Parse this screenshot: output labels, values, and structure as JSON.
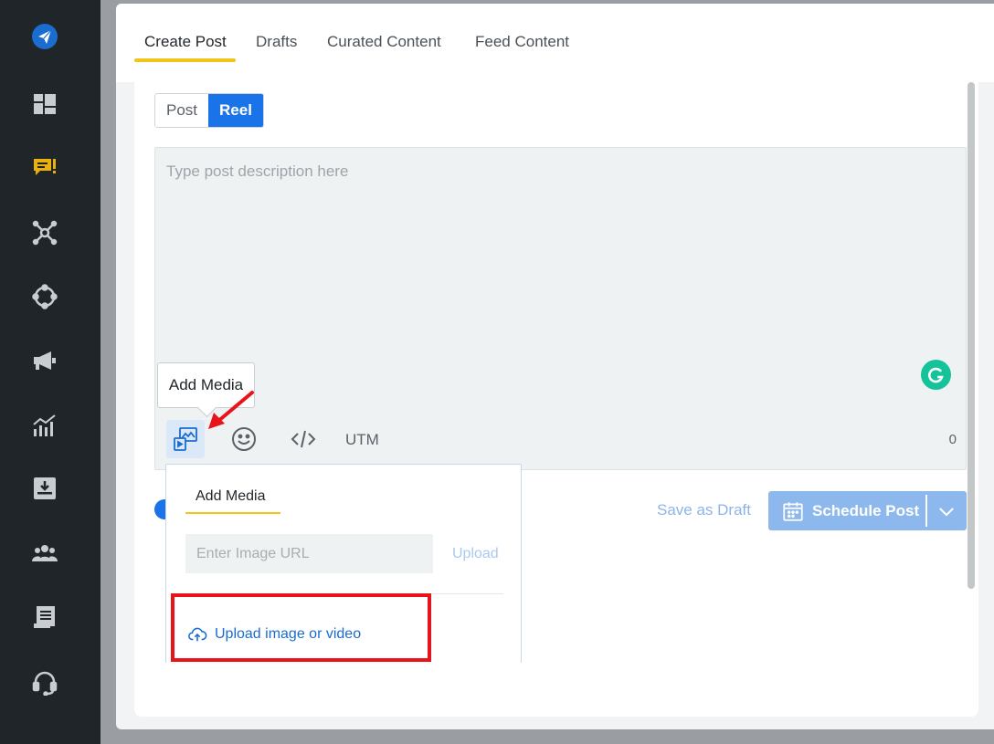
{
  "sidebar": {
    "items": [
      {
        "icon": "paper-plane-logo-icon",
        "color": "#1a6ccf"
      },
      {
        "icon": "dashboard-icon",
        "color": "#c9cdd1"
      },
      {
        "icon": "chat-post-icon",
        "color": "#e8b10e"
      },
      {
        "icon": "network-icon",
        "color": "#c9cdd1"
      },
      {
        "icon": "circle-nodes-icon",
        "color": "#c9cdd1"
      },
      {
        "icon": "megaphone-icon",
        "color": "#c9cdd1"
      },
      {
        "icon": "analytics-icon",
        "color": "#c9cdd1"
      },
      {
        "icon": "inbox-download-icon",
        "color": "#c9cdd1"
      },
      {
        "icon": "team-icon",
        "color": "#c9cdd1"
      },
      {
        "icon": "report-icon",
        "color": "#c9cdd1"
      },
      {
        "icon": "headset-icon",
        "color": "#c9cdd1"
      }
    ]
  },
  "tabs": [
    {
      "label": "Create Post",
      "active": true
    },
    {
      "label": "Drafts",
      "active": false
    },
    {
      "label": "Curated Content",
      "active": false
    },
    {
      "label": "Feed Content",
      "active": false
    }
  ],
  "post_type": {
    "post_label": "Post",
    "reel_label": "Reel",
    "selected": "Reel"
  },
  "editor": {
    "placeholder": "Type post description here",
    "char_count": "0",
    "utm_label": "UTM"
  },
  "tooltip": {
    "text": "Add Media"
  },
  "actions": {
    "save_draft": "Save as Draft",
    "schedule": "Schedule Post"
  },
  "media_dropdown": {
    "title": "Add Media",
    "url_placeholder": "Enter Image URL",
    "upload_link": "Upload",
    "upload_file": "Upload image or video"
  },
  "colors": {
    "accent": "#1a73e8",
    "tab_underline": "#f0c419",
    "highlight": "#e8141b",
    "grammarly": "#15c39a"
  }
}
